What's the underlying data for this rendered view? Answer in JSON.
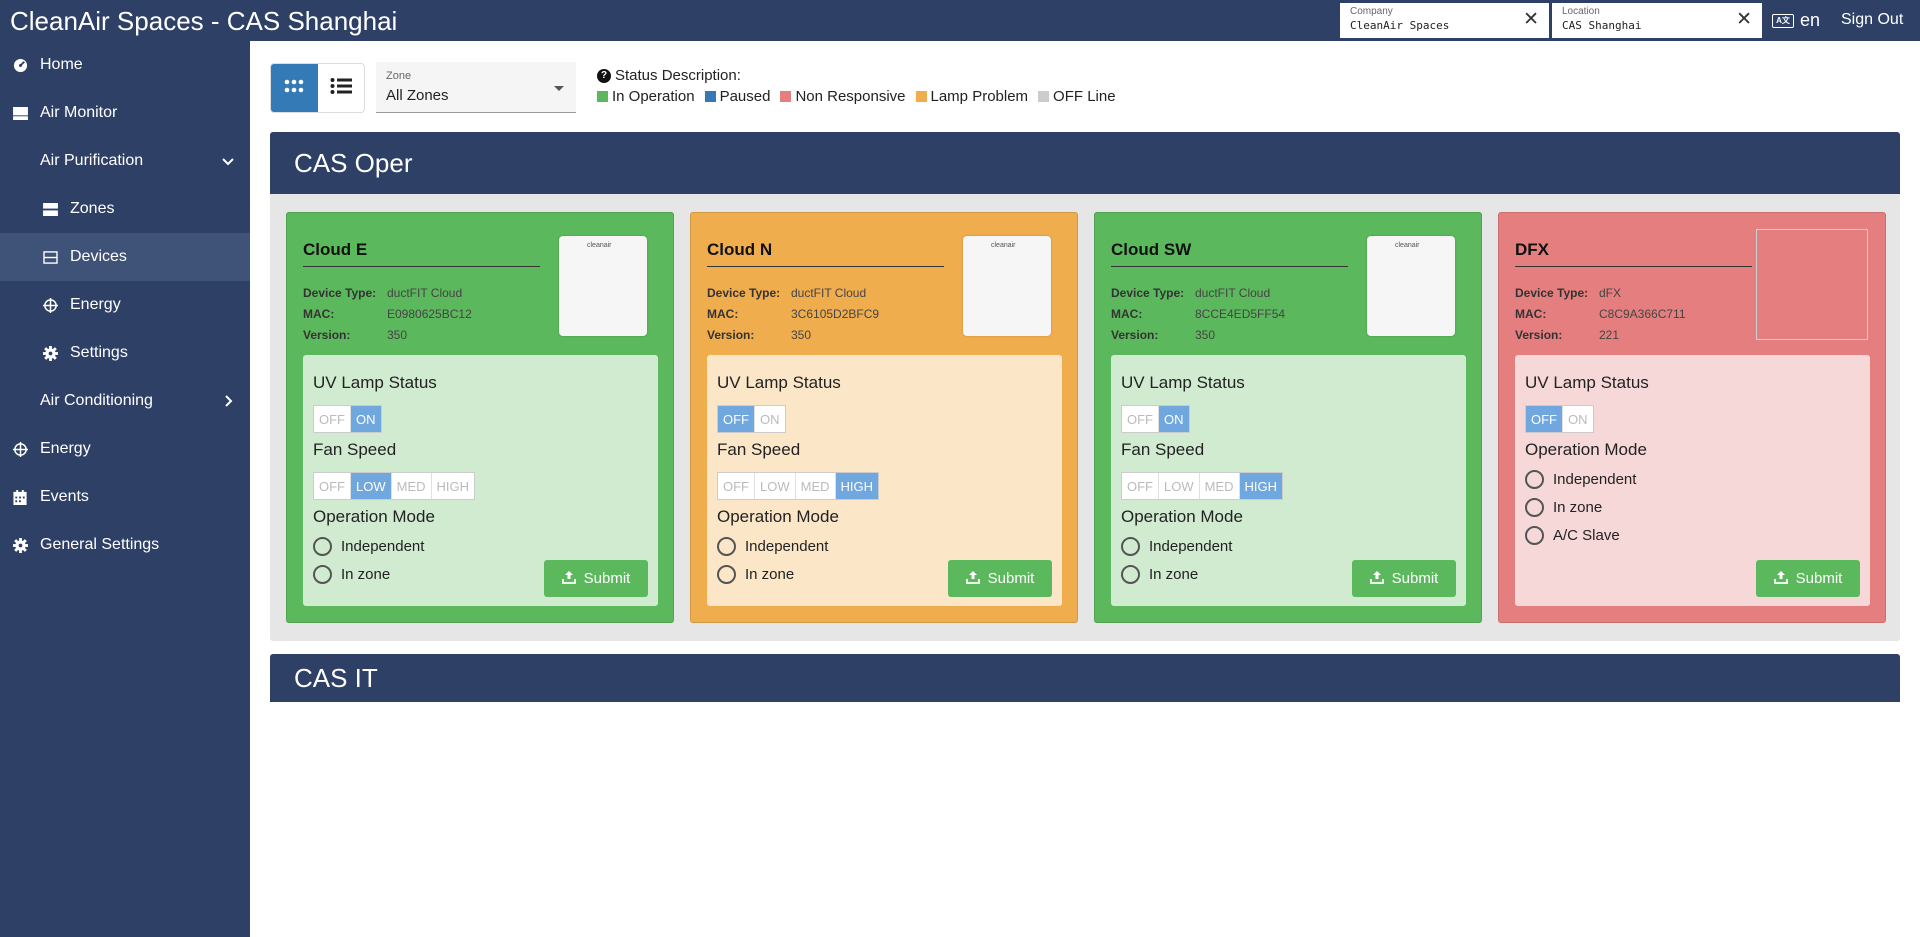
{
  "app": {
    "title": "CleanAir Spaces - CAS Shanghai"
  },
  "context": {
    "company_caption": "Company",
    "company_value": "CleanAir Spaces",
    "location_caption": "Location",
    "location_value": "CAS Shanghai",
    "language": "en",
    "sign_out": "Sign Out"
  },
  "sidebar": {
    "items": [
      {
        "label": "Home",
        "icon": "dashboard-icon"
      },
      {
        "label": "Air Monitor",
        "icon": "monitor-icon"
      },
      {
        "label": "Air Purification",
        "icon": "chevron-down-icon"
      },
      {
        "label": "Zones",
        "icon": "zones-icon"
      },
      {
        "label": "Devices",
        "icon": "devices-icon",
        "active": true
      },
      {
        "label": "Energy",
        "icon": "energy-icon"
      },
      {
        "label": "Settings",
        "icon": "gear-icon"
      },
      {
        "label": "Air Conditioning",
        "icon": "chevron-right-icon"
      },
      {
        "label": "Energy",
        "icon": "energy-icon"
      },
      {
        "label": "Events",
        "icon": "calendar-icon"
      },
      {
        "label": "General Settings",
        "icon": "gear-icon"
      }
    ]
  },
  "toolbar": {
    "zone_caption": "Zone",
    "zone_value": "All Zones",
    "status_title": "Status Description:",
    "legend": [
      {
        "label": "In Operation",
        "color": "#5cb85c"
      },
      {
        "label": "Paused",
        "color": "#337ab7"
      },
      {
        "label": "Non Responsive",
        "color": "#e57f7f"
      },
      {
        "label": "Lamp Problem",
        "color": "#f0ad4e"
      },
      {
        "label": "OFF Line",
        "color": "#cccccc"
      }
    ]
  },
  "zones": [
    {
      "title": "CAS Oper",
      "devices": [
        {
          "name": "Cloud E",
          "type_label": "Device Type:",
          "type": "ductFIT Cloud",
          "mac_label": "MAC:",
          "mac": "E0980625BC12",
          "version_label": "Version:",
          "version": "350",
          "uv_title": "UV Lamp Status",
          "fan_title": "Fan Speed",
          "mode_title": "Operation Mode",
          "uv": "ON",
          "fan": "LOW",
          "modes": [
            "Independent",
            "In zone"
          ],
          "submit": "Submit",
          "color": "#5cb85c",
          "panel_color": "#d1ebd1",
          "thumb_text": "cleanair"
        },
        {
          "name": "Cloud N",
          "type_label": "Device Type:",
          "type": "ductFIT Cloud",
          "mac_label": "MAC:",
          "mac": "3C6105D2BFC9",
          "version_label": "Version:",
          "version": "350",
          "uv_title": "UV Lamp Status",
          "fan_title": "Fan Speed",
          "mode_title": "Operation Mode",
          "uv": "OFF",
          "fan": "HIGH",
          "modes": [
            "Independent",
            "In zone"
          ],
          "submit": "Submit",
          "color": "#f0ad4e",
          "panel_color": "#fbe6c8",
          "thumb_text": "cleanair"
        },
        {
          "name": "Cloud SW",
          "type_label": "Device Type:",
          "type": "ductFIT Cloud",
          "mac_label": "MAC:",
          "mac": "8CCE4ED5FF54",
          "version_label": "Version:",
          "version": "350",
          "uv_title": "UV Lamp Status",
          "fan_title": "Fan Speed",
          "mode_title": "Operation Mode",
          "uv": "ON",
          "fan": "HIGH",
          "modes": [
            "Independent",
            "In zone"
          ],
          "submit": "Submit",
          "color": "#5cb85c",
          "panel_color": "#d1ebd1",
          "thumb_text": "cleanair"
        },
        {
          "name": "DFX",
          "type_label": "Device Type:",
          "type": "dFX",
          "mac_label": "MAC:",
          "mac": "C8C9A366C711",
          "version_label": "Version:",
          "version": "221",
          "uv_title": "UV Lamp Status",
          "mode_title": "Operation Mode",
          "uv": "OFF",
          "modes": [
            "Independent",
            "In zone",
            "A/C Slave"
          ],
          "submit": "Submit",
          "color": "#e57f7f",
          "panel_color": "#f7d8d8"
        }
      ]
    },
    {
      "title": "CAS IT",
      "devices": []
    }
  ],
  "seg_options": {
    "uv": [
      "OFF",
      "ON"
    ],
    "fan": [
      "OFF",
      "LOW",
      "MED",
      "HIGH"
    ]
  }
}
